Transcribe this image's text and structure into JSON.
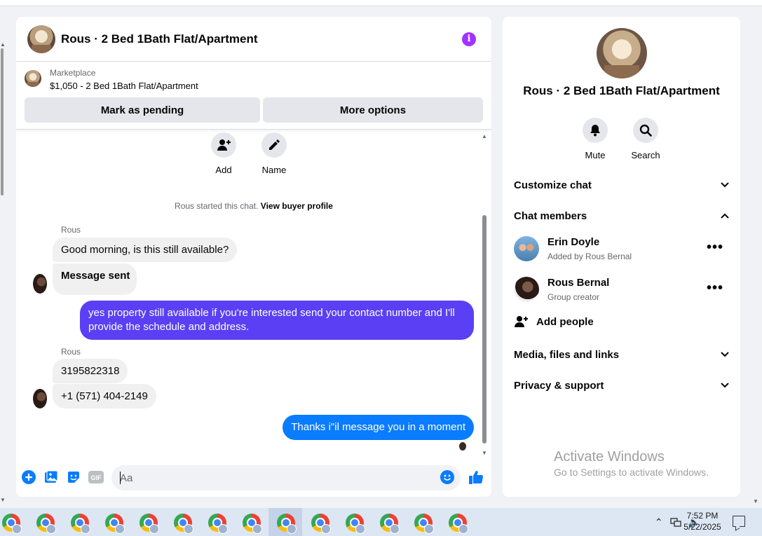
{
  "header": {
    "title": "Rous · 2 Bed 1Bath Flat/Apartment"
  },
  "marketplace": {
    "label": "Marketplace",
    "price_line": "$1,050 - 2 Bed 1Bath Flat/Apartment",
    "buttons": [
      "Mark as pending",
      "More options"
    ]
  },
  "thread": {
    "quick_actions": [
      {
        "label": "Add",
        "icon": "add-person-icon"
      },
      {
        "label": "Name",
        "icon": "pencil-icon"
      }
    ],
    "system_message": "Rous started this chat.",
    "system_link": "View buyer profile",
    "messages": [
      {
        "sender": "Rous",
        "text": "Good morning, is this still available?"
      },
      {
        "text": "Message sent"
      },
      {
        "outgoing": true,
        "text": "yes property still available if you're interested send your contact number and I'll provide the schedule and address."
      },
      {
        "sender": "Rous",
        "text": "3195822318"
      },
      {
        "text": "+1 (571) 404-2149"
      },
      {
        "outgoing": true,
        "text": "Thanks i\"il message you in a moment"
      }
    ]
  },
  "composer": {
    "placeholder": "Aa",
    "icons": [
      "plus-circle-icon",
      "photo-icon",
      "sticker-icon",
      "gif-icon",
      "emoji-icon",
      "thumbs-up-icon"
    ]
  },
  "info_panel": {
    "title": "Rous · 2 Bed 1Bath Flat/Apartment",
    "actions": [
      "Mute",
      "Search"
    ],
    "sections": {
      "customize": "Customize chat",
      "members": "Chat members",
      "media": "Media, files and links",
      "privacy": "Privacy & support"
    },
    "members": [
      {
        "name": "Erin Doyle",
        "sub": "Added by Rous Bernal"
      },
      {
        "name": "Rous Bernal",
        "sub": "Group creator"
      }
    ],
    "add_people": "Add people",
    "watermark": {
      "line1": "Activate Windows",
      "line2": "Go to Settings to activate Windows."
    }
  },
  "taskbar": {
    "time": "7:52 PM",
    "date": "5/22/2025",
    "app_count": 14
  },
  "colors": {
    "accent_purple": "#5b3ff5",
    "accent_blue": "#0a7cff",
    "info_purple": "#a033ff"
  }
}
